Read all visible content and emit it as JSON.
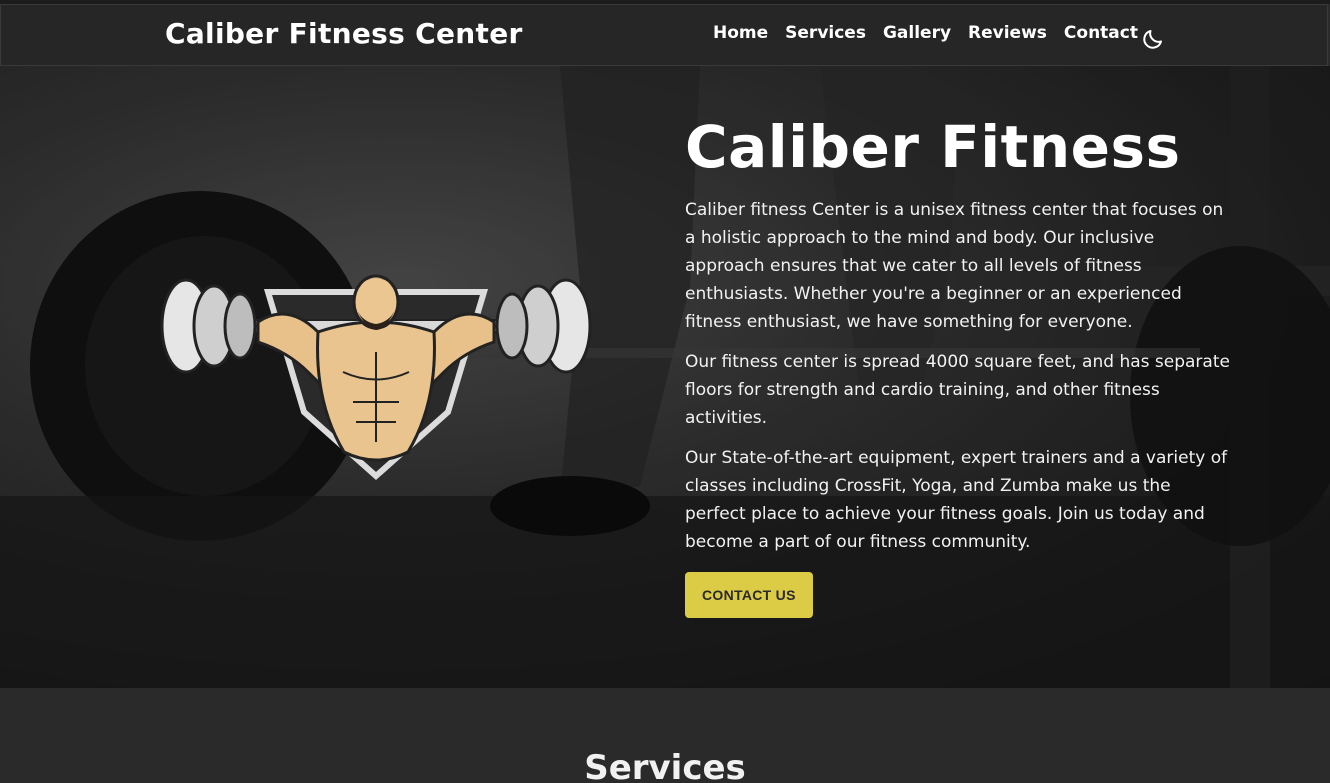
{
  "navbar": {
    "brand": "Caliber Fitness Center",
    "links": [
      "Home",
      "Services",
      "Gallery",
      "Reviews",
      "Contact"
    ],
    "theme_toggle_icon": "moon-icon"
  },
  "hero": {
    "title": "Caliber Fitness",
    "paragraphs": [
      "Caliber fitness Center is a unisex fitness center that focuses on a holistic approach to the mind and body. Our inclusive approach ensures that we cater to all levels of fitness enthusiasts. Whether you're a beginner or an experienced fitness enthusiast, we have something for everyone.",
      "Our fitness center is spread 4000 square feet, and has separate floors for strength and cardio training, and other fitness activities.",
      "Our State-of-the-art equipment, expert trainers and a variety of classes including CrossFit, Yoga, and Zumba make us the perfect place to achieve your fitness goals. Join us today and become a part of our fitness community."
    ],
    "cta_label": "CONTACT US",
    "logo_icon": "bodybuilder-barbell-logo"
  },
  "services": {
    "title": "Services"
  },
  "colors": {
    "accent": "#dccb45",
    "background": "#2b2b2b",
    "navbar": "#262626"
  }
}
